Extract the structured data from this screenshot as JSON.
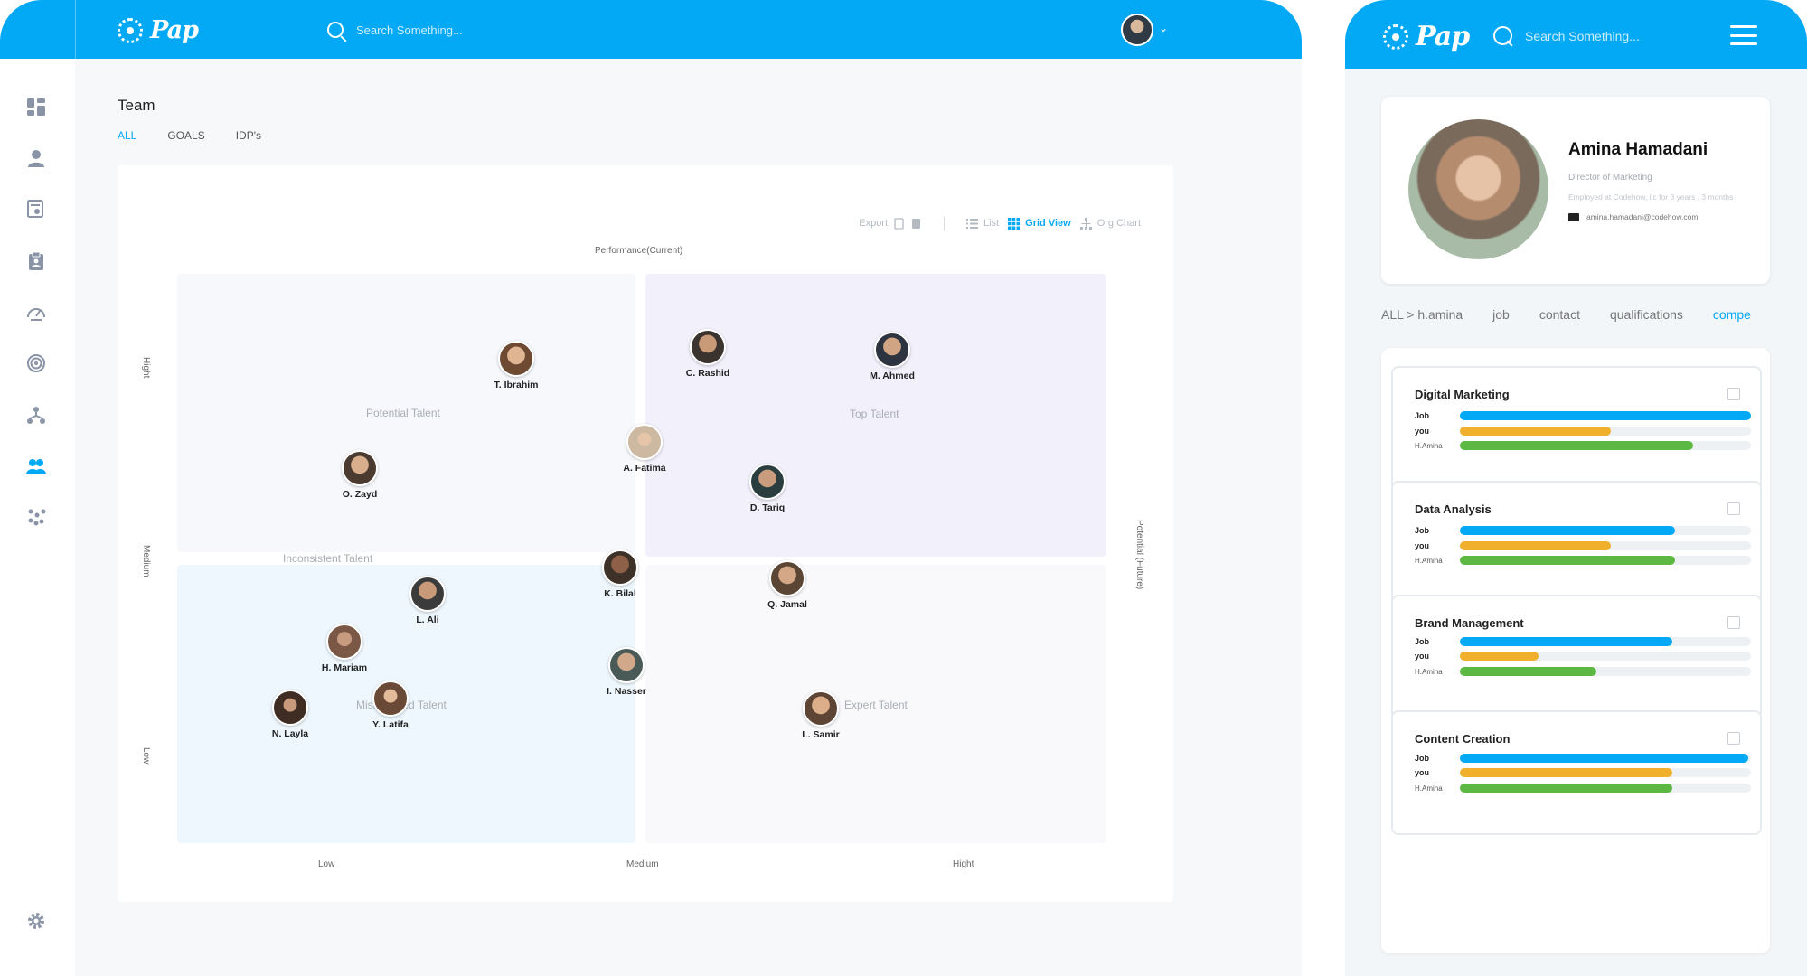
{
  "colors": {
    "brand": "#03a9f4",
    "job": "#03a9f4",
    "you": "#f0b02c",
    "amina": "#5cb843",
    "tl_quad": "#f6f8fc",
    "tr_quad": "#f2f0fb",
    "bl_quad": "#eef7fd",
    "br_quad": "#f9f9fb"
  },
  "desktop": {
    "logo_text": "Pap",
    "search_placeholder": "Search Something...",
    "sidebar_icons": [
      "dashboard-icon",
      "user-icon",
      "certificate-icon",
      "clipboard-icon",
      "speedometer-icon",
      "target-icon",
      "network-icon",
      "team-icon",
      "people-cluster-icon",
      "gear-icon"
    ],
    "page_title": "Team",
    "tabs": [
      "ALL",
      "GOALS",
      "IDP's"
    ],
    "toolbar": {
      "export": "Export",
      "list": "List",
      "grid": "Grid View",
      "org": "Org Chart"
    },
    "axes": {
      "top": "Performance(Current)",
      "left_high": "Hight",
      "left_medium": "Medium",
      "left_low": "Low",
      "bottom_low": "Low",
      "bottom_medium": "Medium",
      "bottom_high": "Hight",
      "right": "Potential (Future)"
    },
    "quadrants": {
      "potential": "Potential Talent",
      "top": "Top Talent",
      "inconsistent": "Inconsistent Talent",
      "mismatched": "Mismatched Talent",
      "expert": "Expert Talent"
    },
    "people": [
      "T. Ibrahim",
      "O. Zayd",
      "C. Rashid",
      "M. Ahmed",
      "A. Fatima",
      "D. Tariq",
      "K. Bilal",
      "Q. Jamal",
      "L. Ali",
      "H. Mariam",
      "I. Nasser",
      "L. Samir",
      "N. Layla",
      "Y. Latifa"
    ]
  },
  "mobile": {
    "logo_text": "Pap",
    "search_placeholder": "Search Something...",
    "profile": {
      "name": "Amina Hamadani",
      "role": "Director of Marketing",
      "employed": "Employed at Codehow, llc for 3 years , 3 months",
      "email": "amina.hamadani@codehow.com"
    },
    "tabs": [
      "ALL > h.amina",
      "job",
      "contact",
      "qualifications",
      "compe"
    ],
    "bar_labels": [
      "Job",
      "you",
      "H.Amina"
    ],
    "skills": [
      {
        "title": "Digital Marketing",
        "job": 1.0,
        "you": 0.52,
        "amina": 0.8
      },
      {
        "title": "Data Analysis",
        "job": 0.74,
        "you": 0.52,
        "amina": 0.74
      },
      {
        "title": "Brand Management",
        "job": 0.73,
        "you": 0.27,
        "amina": 0.47
      },
      {
        "title": "Content Creation",
        "job": 0.99,
        "you": 0.73,
        "amina": 0.73
      }
    ]
  }
}
